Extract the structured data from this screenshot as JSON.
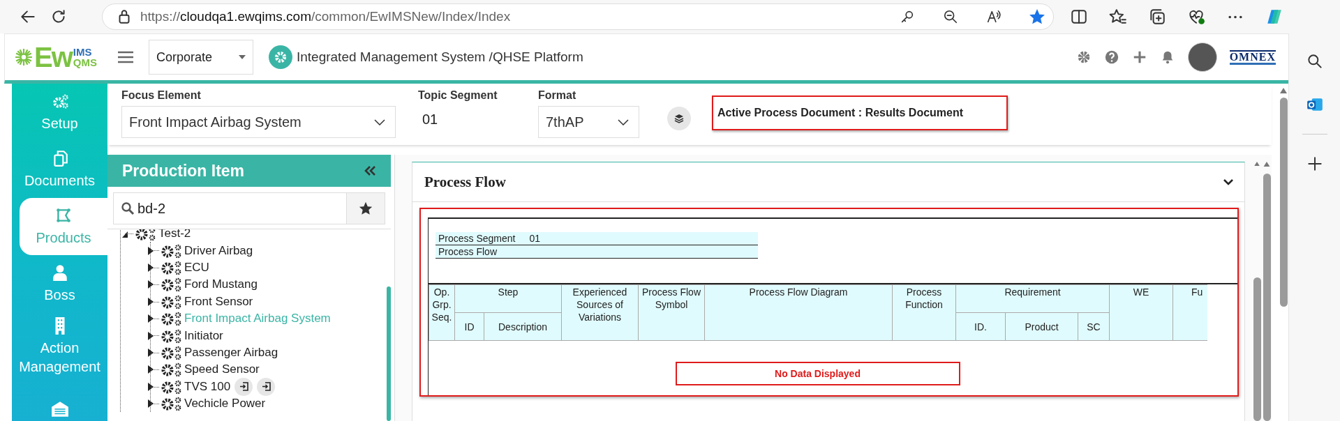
{
  "browser": {
    "url": {
      "scheme": "https://",
      "host": "cloudqa1.ewqims.com",
      "path": "/common/EwIMSNew/Index/Index"
    },
    "favorite": true
  },
  "header": {
    "logo": {
      "main": "Ew",
      "top": "IMS",
      "bottom": "QMS"
    },
    "site": "Corporate",
    "title": "Integrated Management System /QHSE Platform",
    "brand": "OMNEX"
  },
  "nav": [
    {
      "label": "Setup",
      "kind": "gears",
      "selected": false
    },
    {
      "label": "Documents",
      "kind": "documents",
      "selected": false
    },
    {
      "label": "Products",
      "kind": "products",
      "selected": true
    },
    {
      "label": "Boss",
      "kind": "person",
      "selected": false
    },
    {
      "label": "Action Management",
      "kind": "building",
      "selected": false
    },
    {
      "kind": "warehouse",
      "selected": false
    }
  ],
  "filters": {
    "focus_element": {
      "label": "Focus Element",
      "value": "Front Impact Airbag System"
    },
    "topic_segment": {
      "label": "Topic Segment",
      "value": "01"
    },
    "format": {
      "label": "Format",
      "value": "7thAP"
    },
    "active_document": "Active Process Document : Results Document"
  },
  "tree_panel": {
    "title": "Production Item",
    "search": {
      "value": "bd-2"
    },
    "items": [
      {
        "label": "Test-2",
        "expanded": true,
        "selected": false,
        "has_actions": false,
        "children": [
          {
            "label": "Driver Airbag",
            "expanded": false,
            "selected": false,
            "has_actions": false
          },
          {
            "label": "ECU",
            "expanded": false,
            "selected": false,
            "has_actions": false
          },
          {
            "label": "Ford Mustang",
            "expanded": false,
            "selected": false,
            "has_actions": false
          },
          {
            "label": "Front Sensor",
            "expanded": false,
            "selected": false,
            "has_actions": false
          },
          {
            "label": "Front Impact Airbag System",
            "expanded": false,
            "selected": true,
            "has_actions": false
          },
          {
            "label": "Initiator",
            "expanded": false,
            "selected": false,
            "has_actions": false
          },
          {
            "label": "Passenger Airbag",
            "expanded": false,
            "selected": false,
            "has_actions": false
          },
          {
            "label": "Speed Sensor",
            "expanded": false,
            "selected": false,
            "has_actions": false
          },
          {
            "label": "TVS 100",
            "expanded": false,
            "selected": false,
            "has_actions": true
          },
          {
            "label": "Vechicle Power",
            "expanded": false,
            "selected": false,
            "has_actions": false
          }
        ]
      }
    ]
  },
  "process_flow": {
    "title": "Process Flow",
    "expanded": true,
    "segment": {
      "label": "Process Segment",
      "value": "01"
    },
    "flow_label": "Process Flow",
    "columns": [
      {
        "label": "Op. Grp. Seq."
      },
      {
        "label": "Step",
        "children": [
          {
            "label": "ID"
          },
          {
            "label": "Description"
          }
        ]
      },
      {
        "label": "Experienced Sources of Variations"
      },
      {
        "label": "Process Flow Symbol"
      },
      {
        "label": "Process Flow Diagram"
      },
      {
        "label": "Process Function"
      },
      {
        "label": "Requirement",
        "children": [
          {
            "label": "ID."
          },
          {
            "label": "Product"
          },
          {
            "label": "SC"
          }
        ]
      },
      {
        "label": "WE"
      },
      {
        "label": "Fu"
      }
    ],
    "empty_message": "No Data Displayed"
  }
}
